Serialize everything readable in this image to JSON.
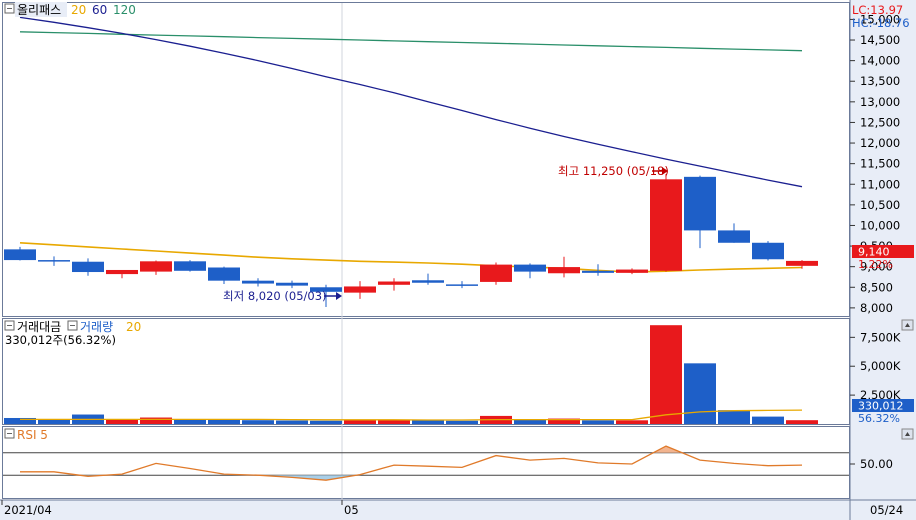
{
  "header": {
    "stock_name": "올리패스",
    "ma_periods": [
      "20",
      "60",
      "120"
    ],
    "lc_label": "LC:13.97",
    "hc_label": "HC:-18.76"
  },
  "colors": {
    "up": "#e8191c",
    "down": "#1e5fc8",
    "ma20": "#e8a800",
    "ma60": "#1b1f90",
    "ma120": "#2a8f6a",
    "rsi": "#e07a2a",
    "frame": "#6b7a99",
    "bg": "#ffffff",
    "axis_bg": "#e8edf7"
  },
  "annotations": {
    "high": "최고 11,250 (05/18)",
    "low": "최저 8,020 (05/03)"
  },
  "price_tag": {
    "value": "9,140",
    "change": "1.22%"
  },
  "volume_panel": {
    "title1": "거래대금",
    "title2": "거래량",
    "ma_period": "20",
    "summary": "330,012주(56.32%)",
    "tag_value": "330,012",
    "tag_pct": "56.32%"
  },
  "rsi_panel": {
    "title": "RSI 5"
  },
  "x_axis": {
    "left_label": "2021/04",
    "mid_label": "05",
    "right_label": "05/24"
  },
  "chart_data": {
    "type": "candlestick",
    "price_ylim": [
      7900,
      15350
    ],
    "price_ticks": [
      8000,
      8500,
      9000,
      9500,
      10000,
      10500,
      11000,
      11500,
      12000,
      12500,
      13000,
      13500,
      14000,
      14500,
      15000
    ],
    "price_tick_labels": [
      "8,000",
      "8,500",
      "9,000",
      "9,500",
      "10,000",
      "10,500",
      "11,000",
      "11,500",
      "12,000",
      "12,500",
      "13,000",
      "13,500",
      "14,000",
      "14,500",
      "15,000"
    ],
    "candles": [
      {
        "o": 9420,
        "h": 9480,
        "l": 9150,
        "c": 9160
      },
      {
        "o": 9160,
        "h": 9250,
        "l": 9020,
        "c": 9130
      },
      {
        "o": 9120,
        "h": 9200,
        "l": 8780,
        "c": 8870
      },
      {
        "o": 8820,
        "h": 8920,
        "l": 8720,
        "c": 8920
      },
      {
        "o": 8880,
        "h": 9150,
        "l": 8800,
        "c": 9130
      },
      {
        "o": 9130,
        "h": 9160,
        "l": 8880,
        "c": 8900
      },
      {
        "o": 8980,
        "h": 9000,
        "l": 8580,
        "c": 8660
      },
      {
        "o": 8660,
        "h": 8720,
        "l": 8520,
        "c": 8590
      },
      {
        "o": 8610,
        "h": 8660,
        "l": 8480,
        "c": 8540
      },
      {
        "o": 8500,
        "h": 8560,
        "l": 8020,
        "c": 8390
      },
      {
        "o": 8370,
        "h": 8650,
        "l": 8220,
        "c": 8520
      },
      {
        "o": 8560,
        "h": 8720,
        "l": 8420,
        "c": 8640
      },
      {
        "o": 8670,
        "h": 8830,
        "l": 8560,
        "c": 8610
      },
      {
        "o": 8570,
        "h": 8650,
        "l": 8480,
        "c": 8540
      },
      {
        "o": 8630,
        "h": 9100,
        "l": 8560,
        "c": 9050
      },
      {
        "o": 9050,
        "h": 9080,
        "l": 8720,
        "c": 8880
      },
      {
        "o": 8840,
        "h": 9240,
        "l": 8740,
        "c": 8990
      },
      {
        "o": 8900,
        "h": 9060,
        "l": 8780,
        "c": 8850
      },
      {
        "o": 8850,
        "h": 8960,
        "l": 8820,
        "c": 8930
      },
      {
        "o": 8900,
        "h": 11250,
        "l": 8880,
        "c": 11120
      },
      {
        "o": 11180,
        "h": 11210,
        "l": 9450,
        "c": 9880
      },
      {
        "o": 9880,
        "h": 10050,
        "l": 9580,
        "c": 9580
      },
      {
        "o": 9580,
        "h": 9620,
        "l": 9150,
        "c": 9180
      },
      {
        "o": 9020,
        "h": 9160,
        "l": 8950,
        "c": 9140
      }
    ],
    "ma": [
      {
        "name": "20",
        "values": [
          9580,
          9530,
          9480,
          9430,
          9380,
          9330,
          9280,
          9230,
          9190,
          9160,
          9130,
          9110,
          9090,
          9060,
          9020,
          8990,
          8960,
          8910,
          8870,
          8890,
          8920,
          8940,
          8960,
          8980
        ]
      },
      {
        "name": "60",
        "values": [
          15050,
          14930,
          14800,
          14660,
          14510,
          14350,
          14180,
          14000,
          13810,
          13610,
          13420,
          13220,
          13000,
          12790,
          12570,
          12360,
          12160,
          11970,
          11790,
          11610,
          11440,
          11270,
          11100,
          10940
        ]
      },
      {
        "name": "120",
        "values": [
          14700,
          14680,
          14660,
          14640,
          14620,
          14600,
          14580,
          14560,
          14540,
          14520,
          14500,
          14480,
          14460,
          14440,
          14420,
          14400,
          14380,
          14360,
          14340,
          14320,
          14300,
          14280,
          14260,
          14240
        ]
      }
    ],
    "volume_ylim": [
      0,
      9000
    ],
    "volume_ticks": [
      2500,
      5000,
      7500
    ],
    "volume_tick_labels": [
      "2,500K",
      "5,000K",
      "7,500K"
    ],
    "volume": [
      520,
      420,
      820,
      420,
      560,
      430,
      350,
      330,
      300,
      280,
      320,
      330,
      320,
      280,
      700,
      420,
      470,
      320,
      320,
      8550,
      5250,
      1200,
      640,
      330
    ],
    "volume_ma": [
      400,
      400,
      400,
      400,
      400,
      400,
      400,
      400,
      380,
      360,
      360,
      360,
      350,
      350,
      380,
      380,
      380,
      380,
      380,
      800,
      1050,
      1150,
      1180,
      1200
    ],
    "rsi_ylim": [
      0,
      100
    ],
    "rsi_ticks": [
      50
    ],
    "rsi_tick_labels": [
      "50.00"
    ],
    "rsi_levels": [
      30,
      70
    ],
    "rsi": [
      36,
      36,
      28,
      32,
      51,
      42,
      32,
      30,
      26,
      21,
      31,
      48,
      46,
      44,
      65,
      57,
      60,
      52,
      50,
      82,
      57,
      51,
      47,
      48
    ]
  }
}
